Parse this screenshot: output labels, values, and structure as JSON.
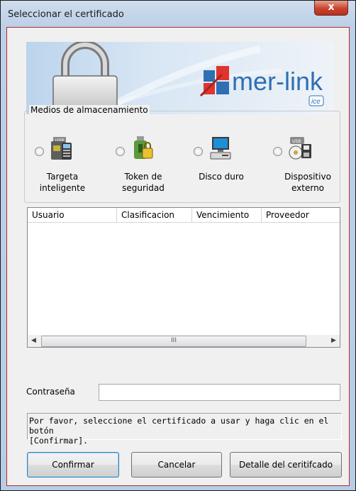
{
  "window": {
    "title": "Seleccionar el certificado",
    "close_glyph": "x"
  },
  "banner": {
    "logo_text": "mer-link",
    "logo_badge": "ice",
    "icon": "padlock-icon"
  },
  "storage": {
    "legend": "Medios de almacenamiento",
    "options": [
      {
        "line1": "Targeta",
        "line2": "inteligente",
        "icon": "smart-card-icon"
      },
      {
        "line1": "Token de",
        "line2": "seguridad",
        "icon": "usb-token-icon"
      },
      {
        "line1": "Disco duro",
        "line2": "",
        "icon": "computer-icon"
      },
      {
        "line1": "Dispositivo",
        "line2": "externo",
        "icon": "external-device-icon"
      }
    ]
  },
  "list": {
    "columns": [
      "Usuario",
      "Clasificacion",
      "Vencimiento",
      "Proveedor"
    ],
    "rows": [],
    "scroll_thumb_glyph": "III"
  },
  "password": {
    "label": "Contraseña",
    "value": ""
  },
  "message": {
    "line1": "Por favor, seleccione el certificado a usar y haga clic en el botón",
    "line2": "[Confirmar]."
  },
  "buttons": {
    "confirm": "Confirmar",
    "cancel": "Cancelar",
    "details": "Detalle del ceritifcado"
  },
  "colors": {
    "frame_border": "#b22a2a",
    "logo_blue": "#2f6fb3",
    "logo_red": "#e0342c"
  }
}
